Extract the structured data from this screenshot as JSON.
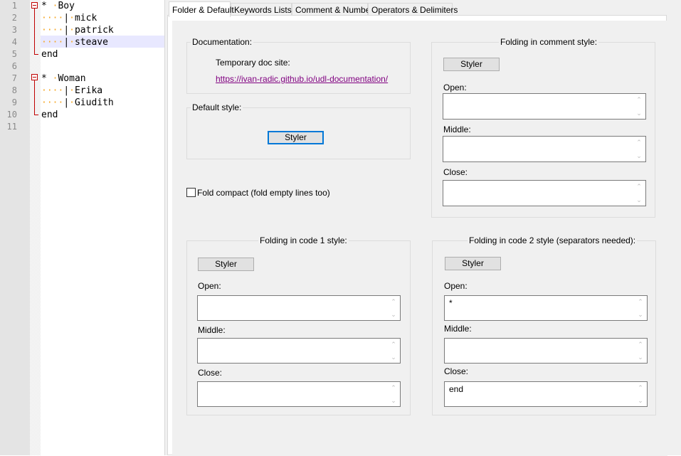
{
  "editor": {
    "line_numbers": [
      "1",
      "2",
      "3",
      "4",
      "5",
      "6",
      "7",
      "8",
      "9",
      "10",
      "11"
    ],
    "lines": [
      {
        "prefix": "* ",
        "ws": "·",
        "text": "Boy"
      },
      {
        "ws": "····",
        "bar": "|",
        "ws2": "·",
        "text": "mick"
      },
      {
        "ws": "····",
        "bar": "|",
        "ws2": "·",
        "text": "patrick"
      },
      {
        "ws": "····",
        "bar": "|",
        "ws2": "·",
        "text": "steave"
      },
      {
        "text": "end"
      },
      {
        "text": ""
      },
      {
        "prefix": "* ",
        "ws": "·",
        "text": "Woman"
      },
      {
        "ws": "····",
        "bar": "|",
        "ws2": "·",
        "text": "Erika"
      },
      {
        "ws": "····",
        "bar": "|",
        "ws2": "·",
        "text": "Giudith"
      },
      {
        "text": "end"
      },
      {
        "text": ""
      }
    ]
  },
  "tabs": [
    {
      "label": "Folder & Default",
      "active": true
    },
    {
      "label": "Keywords Lists"
    },
    {
      "label": "Comment & Number"
    },
    {
      "label": "Operators & Delimiters"
    }
  ],
  "documentation": {
    "title": "Documentation:",
    "label": "Temporary doc site:",
    "link": "https://ivan-radic.github.io/udl-documentation/"
  },
  "default_style": {
    "title": "Default style:",
    "button": "Styler"
  },
  "fold_compact": {
    "label": "Fold compact (fold empty lines too)",
    "checked": false
  },
  "comment_style": {
    "title": "Folding in comment style:",
    "button": "Styler",
    "open_label": "Open:",
    "open_value": "",
    "middle_label": "Middle:",
    "middle_value": "",
    "close_label": "Close:",
    "close_value": ""
  },
  "code1_style": {
    "title": "Folding in code 1 style:",
    "button": "Styler",
    "open_label": "Open:",
    "open_value": "",
    "middle_label": "Middle:",
    "middle_value": "",
    "close_label": "Close:",
    "close_value": ""
  },
  "code2_style": {
    "title": "Folding in code 2 style (separators needed):",
    "button": "Styler",
    "open_label": "Open:",
    "open_value": "*",
    "middle_label": "Middle:",
    "middle_value": "",
    "close_label": "Close:",
    "close_value": "end"
  },
  "colors": {
    "fold_marker": "#c00000",
    "whitespace_dots": "#f5a623",
    "current_line": "#e8e8ff",
    "link": "#800080",
    "focus_border": "#0078d7"
  }
}
